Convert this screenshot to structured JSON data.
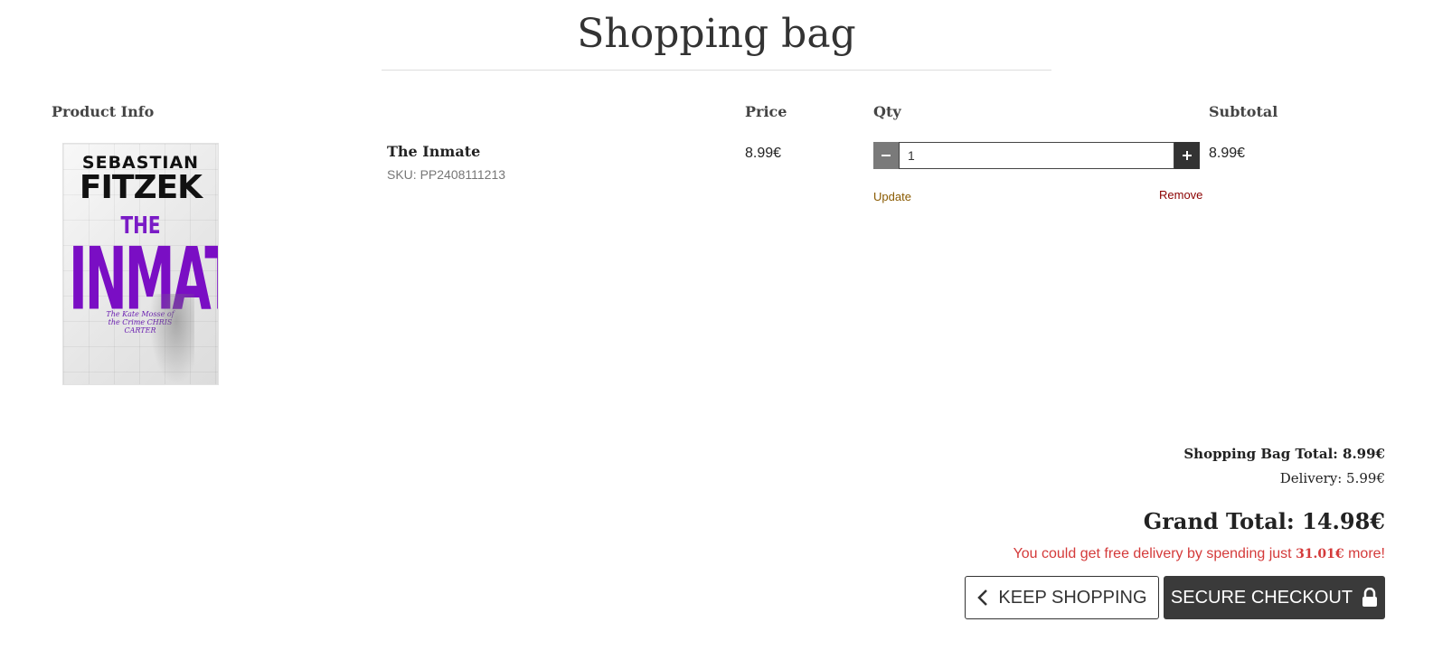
{
  "page": {
    "title": "Shopping bag"
  },
  "columns": {
    "product_info": "Product Info",
    "price": "Price",
    "qty": "Qty",
    "subtotal": "Subtotal"
  },
  "items": [
    {
      "title": "The Inmate",
      "sku": "SKU: PP2408111213",
      "price": "8.99€",
      "qty": "1",
      "subtotal": "8.99€",
      "update_label": "Update",
      "remove_label": "Remove",
      "cover": {
        "author_first": "SEBASTIAN",
        "author_last": "FITZEK",
        "title_top": "THE",
        "title_main": "INMATE",
        "tagline": "The Kate Mosse of the Crime CHRIS CARTER",
        "accent_color": "#7a0ec4"
      }
    }
  ],
  "summary": {
    "bag_total": "Shopping Bag Total: 8.99€",
    "delivery": "Delivery: 5.99€",
    "grand_total": "Grand Total: 14.98€",
    "free_delivery_prefix": "You could get free delivery by spending just ",
    "free_delivery_amount": "31.01€",
    "free_delivery_suffix": " more!"
  },
  "actions": {
    "keep_shopping": "KEEP SHOPPING",
    "checkout": "SECURE CHECKOUT"
  },
  "icons": {
    "minus": "minus-icon",
    "plus": "plus-icon",
    "back": "chevron-left-icon",
    "lock": "lock-icon"
  },
  "colors": {
    "free_note": "#d43a3a",
    "update": "#8a5a00",
    "remove": "#8b0000",
    "checkout_bg": "#3a3a3a"
  }
}
